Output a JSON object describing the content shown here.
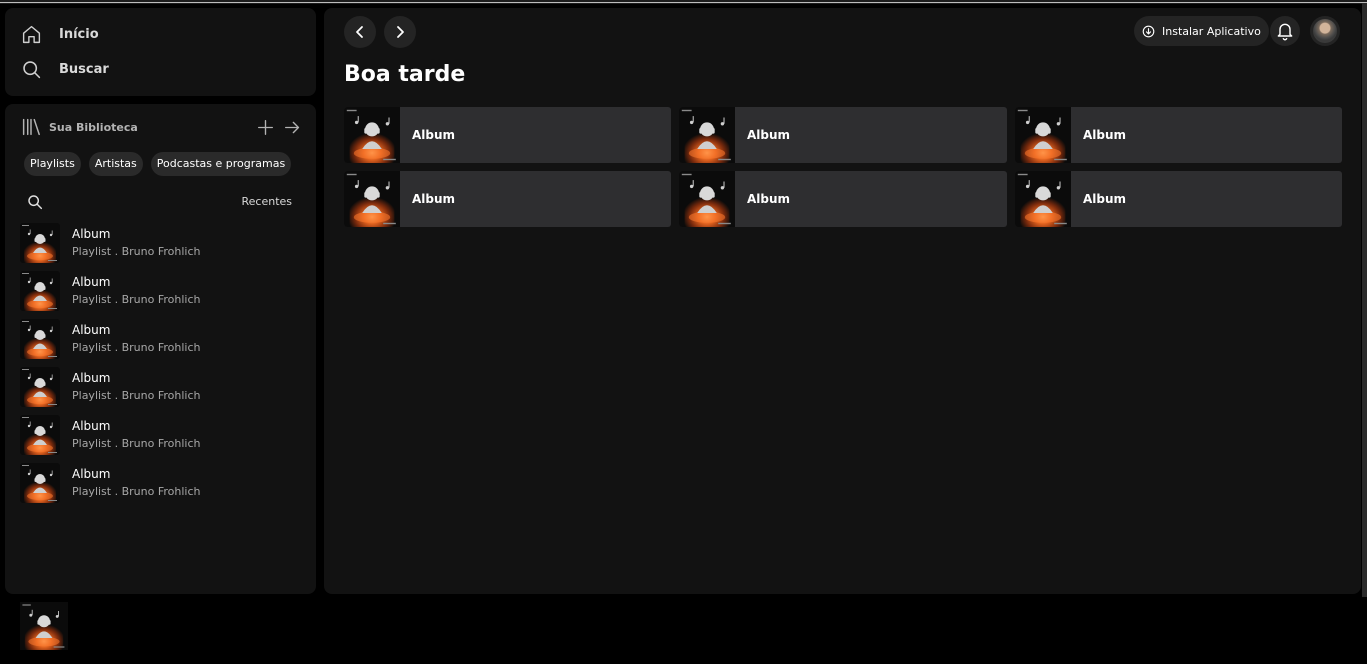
{
  "sidebar": {
    "nav": [
      {
        "label": "Início",
        "icon": "home-icon"
      },
      {
        "label": "Buscar",
        "icon": "search-icon"
      }
    ],
    "library": {
      "title": "Sua Biblioteca",
      "chips": [
        "Playlists",
        "Artistas",
        "Podcastas e programas"
      ],
      "sort_label": "Recentes",
      "items": [
        {
          "name": "Album",
          "subtitle": "Playlist . Bruno Frohlich"
        },
        {
          "name": "Album",
          "subtitle": "Playlist . Bruno Frohlich"
        },
        {
          "name": "Album",
          "subtitle": "Playlist . Bruno Frohlich"
        },
        {
          "name": "Album",
          "subtitle": "Playlist . Bruno Frohlich"
        },
        {
          "name": "Album",
          "subtitle": "Playlist . Bruno Frohlich"
        },
        {
          "name": "Album",
          "subtitle": "Playlist . Bruno Frohlich"
        }
      ]
    }
  },
  "header": {
    "install_label": "Instalar Aplicativo"
  },
  "main": {
    "greeting": "Boa tarde",
    "cards": [
      {
        "name": "Album"
      },
      {
        "name": "Album"
      },
      {
        "name": "Album"
      },
      {
        "name": "Album"
      },
      {
        "name": "Album"
      },
      {
        "name": "Album"
      }
    ]
  },
  "colors": {
    "background": "#000000",
    "panel": "#121212",
    "card": "#2e2e30",
    "chip": "#2a2a2a",
    "subtext": "#a7a7a7",
    "art_fire": "#d2561e"
  }
}
